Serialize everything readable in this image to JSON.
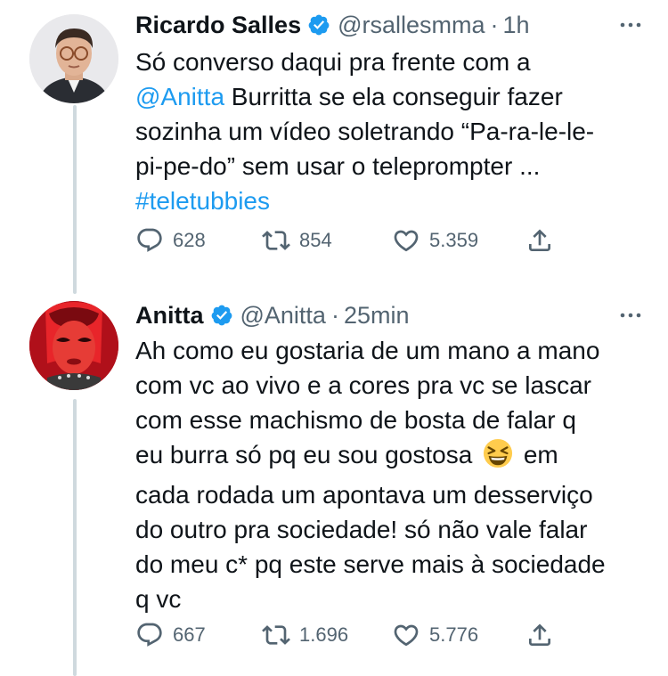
{
  "tweets": [
    {
      "author": {
        "name": "Ricardo Salles",
        "handle": "@rsallesmma",
        "separator": "·",
        "time": "1h",
        "avatar": "person-with-glasses-avatar"
      },
      "text_lines": [
        "Só converso daqui pra frente com a",
        [
          {
            "t": "@Anitta",
            "link": true
          },
          {
            "t": " Burritta se ela conseguir fazer",
            "link": false
          }
        ],
        "sozinha um vídeo soletrando “Pa-ra-le-le-",
        "pi-pe-do” sem usar o teleprompter ...",
        [
          {
            "t": "#teletubbies",
            "link": true
          }
        ]
      ],
      "stats": {
        "replies": "628",
        "retweets": "854",
        "likes": "5.359"
      }
    },
    {
      "author": {
        "name": "Anitta",
        "handle": "@Anitta",
        "separator": "·",
        "time": "25min",
        "avatar": "red-stylized-face-avatar"
      },
      "text_lines": [
        "Ah como eu gostaria de um mano a mano",
        "com vc ao vivo e a cores pra vc se lascar",
        "com esse machismo de bosta de falar q",
        [
          {
            "t": "eu burra só pq eu sou gostosa ",
            "link": false
          },
          {
            "emoji": "laughing-squint-emoji"
          },
          {
            "t": " em",
            "link": false
          }
        ],
        "cada rodada um apontava um desserviço",
        "do outro pra sociedade! só não vale falar",
        "do meu c* pq este serve mais à sociedade",
        "q vc"
      ],
      "stats": {
        "replies": "667",
        "retweets": "1.696",
        "likes": "5.776"
      }
    }
  ],
  "colors": {
    "text": "#0f1419",
    "secondary": "#536471",
    "link": "#1d9bf0",
    "verified": "#1d9bf0",
    "thread_line": "#cfd9de"
  }
}
